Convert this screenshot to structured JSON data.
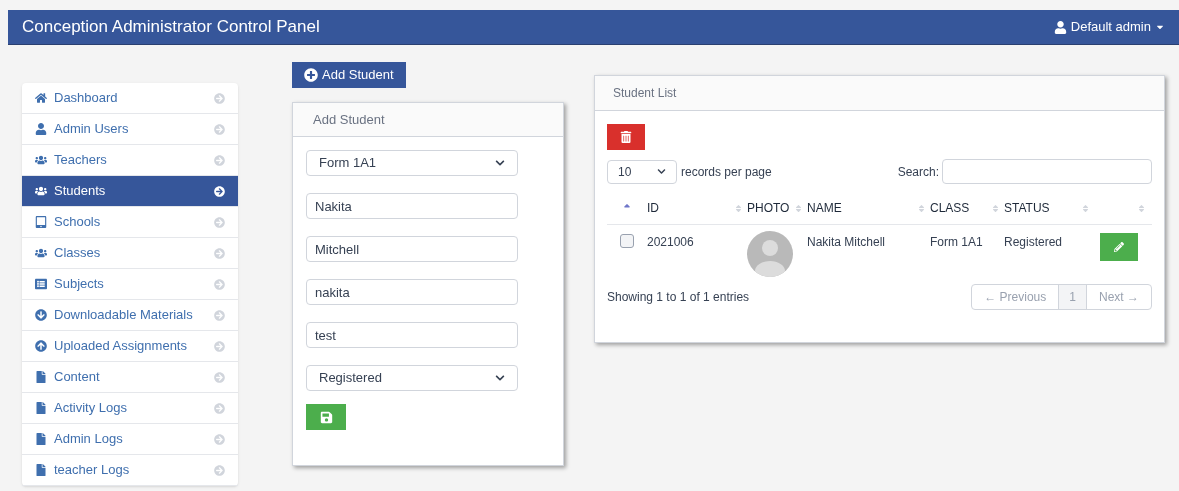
{
  "header": {
    "title": "Conception Administrator Control Panel",
    "user": "Default admin"
  },
  "sidebar": {
    "items": [
      {
        "label": "Dashboard",
        "selected": false
      },
      {
        "label": "Admin Users",
        "selected": false
      },
      {
        "label": "Teachers",
        "selected": false
      },
      {
        "label": "Students",
        "selected": true
      },
      {
        "label": "Schools",
        "selected": false
      },
      {
        "label": "Classes",
        "selected": false
      },
      {
        "label": "Subjects",
        "selected": false
      },
      {
        "label": "Downloadable Materials",
        "selected": false
      },
      {
        "label": "Uploaded Assignments",
        "selected": false
      },
      {
        "label": "Content",
        "selected": false
      },
      {
        "label": "Activity Logs",
        "selected": false
      },
      {
        "label": "Admin Logs",
        "selected": false
      },
      {
        "label": "teacher Logs",
        "selected": false
      }
    ]
  },
  "add_button": "Add Student",
  "form": {
    "title": "Add Student",
    "fields": [
      {
        "kind": "select",
        "value": "Form 1A1"
      },
      {
        "kind": "text",
        "value": "Nakita"
      },
      {
        "kind": "text",
        "value": "Mitchell"
      },
      {
        "kind": "text",
        "value": "nakita"
      },
      {
        "kind": "text",
        "value": "test"
      },
      {
        "kind": "select",
        "value": "Registered"
      }
    ]
  },
  "list": {
    "title": "Student List",
    "page_size": "10",
    "page_size_label": "records per page",
    "search_label": "Search:",
    "table": {
      "sorted_ascending": true,
      "columns": [
        "ID",
        "PHOTO",
        "NAME",
        "CLASS",
        "STATUS"
      ],
      "rows": [
        {
          "checked": false,
          "id": "2021006",
          "name": "Nakita Mitchell",
          "class": "Form 1A1",
          "status": "Registered"
        }
      ]
    },
    "info": "Showing 1 to 1 of 1 entries",
    "pagination": {
      "previous": "← Previous",
      "pages": [
        {
          "label": "1",
          "selected": true
        }
      ],
      "next": "Next →"
    }
  }
}
